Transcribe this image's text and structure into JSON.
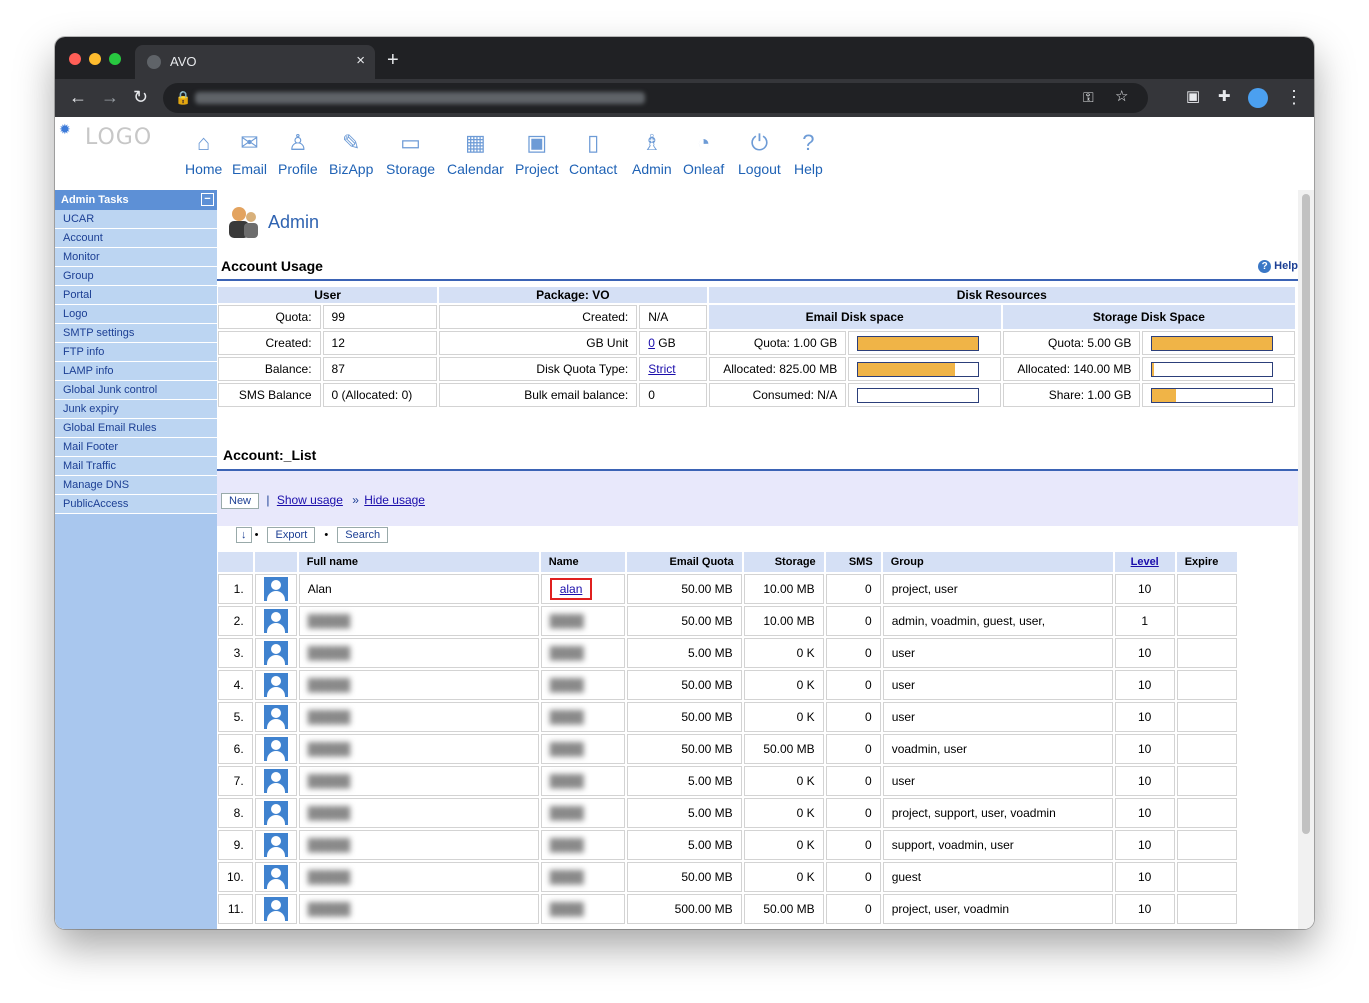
{
  "browser": {
    "tab_title": "AVO",
    "new_tab": "+",
    "close": "×"
  },
  "nav": [
    {
      "label": "Home",
      "icon": "home-icon",
      "glyph": "⌂"
    },
    {
      "label": "Email",
      "icon": "email-icon",
      "glyph": "✉"
    },
    {
      "label": "Profile",
      "icon": "profile-icon",
      "glyph": "♙"
    },
    {
      "label": "BizApp",
      "icon": "bizapp-icon",
      "glyph": "✎"
    },
    {
      "label": "Storage",
      "icon": "storage-icon",
      "glyph": "▭"
    },
    {
      "label": "Calendar",
      "icon": "calendar-icon",
      "glyph": "▦"
    },
    {
      "label": "Project",
      "icon": "project-icon",
      "glyph": "▣"
    },
    {
      "label": "Contact",
      "icon": "contact-icon",
      "glyph": "▯"
    },
    {
      "label": "Admin",
      "icon": "admin-icon",
      "glyph": "♗"
    },
    {
      "label": "Onleaf",
      "icon": "onleaf-icon",
      "glyph": "◔"
    },
    {
      "label": "Logout",
      "icon": "logout-icon",
      "glyph": "⏻"
    },
    {
      "label": "Help",
      "icon": "help-icon",
      "glyph": "?"
    }
  ],
  "logo": {
    "text": "LOGO"
  },
  "sidebar": {
    "title": "Admin Tasks",
    "collapse": "−",
    "items": [
      "UCAR",
      "Account",
      "Monitor",
      "Group",
      "Portal",
      "Logo",
      "SMTP settings",
      "FTP info",
      "LAMP info",
      "Global Junk control",
      "Junk expiry",
      "Global Email Rules",
      "Mail Footer",
      "Mail Traffic",
      "Manage DNS",
      "PublicAccess"
    ]
  },
  "main": {
    "title": "Admin",
    "usage_title": "Account Usage",
    "help": "Help",
    "headers": {
      "user": "User",
      "package": "Package: VO",
      "disk": "Disk Resources",
      "email_disk": "Email Disk space",
      "storage_disk": "Storage Disk Space"
    },
    "user_rows": [
      {
        "label": "Quota:",
        "value": "99"
      },
      {
        "label": "Created:",
        "value": "12"
      },
      {
        "label": "Balance:",
        "value": "87"
      },
      {
        "label": "SMS Balance",
        "value": "0 (Allocated: 0)"
      }
    ],
    "package_rows": [
      {
        "label": "Created:",
        "value": "N/A"
      },
      {
        "label": "GB Unit",
        "link": "0",
        "value": " GB"
      },
      {
        "label": "Disk Quota Type:",
        "link": "Strict"
      },
      {
        "label": "Bulk email balance:",
        "value": "0"
      }
    ],
    "email_disk": [
      {
        "label": "Quota: 1.00 GB",
        "level": 1.0
      },
      {
        "label": "Allocated: 825.00 MB",
        "level": 0.806
      },
      {
        "label": "Consumed: N/A",
        "level": 0
      }
    ],
    "storage_disk": [
      {
        "label": "Quota: 5.00 GB",
        "level": 1.0
      },
      {
        "label": "Allocated: 140.00 MB",
        "level": 0.027
      },
      {
        "label": "Share: 1.00 GB",
        "level": 0.2
      }
    ],
    "list_title": "Account:_List",
    "new_btn": "New",
    "sep": "|",
    "show_usage": "Show usage",
    "raquo": "»",
    "hide_usage": "Hide usage",
    "sort_btn": "↓",
    "bullet": "•",
    "export_btn": "Export",
    "search_btn": "Search",
    "columns": [
      "",
      "",
      "Full name",
      "Name",
      "Email Quota",
      "Storage",
      "SMS",
      "Group",
      "Level",
      "Expire"
    ],
    "rows": [
      {
        "n": "1.",
        "full": "Alan",
        "name": "alan",
        "quota": "50.00 MB",
        "storage": "10.00 MB",
        "sms": "0",
        "group": "project, user",
        "level": "10"
      },
      {
        "n": "2.",
        "full": "",
        "name": "",
        "quota": "50.00 MB",
        "storage": "10.00 MB",
        "sms": "0",
        "group": "admin, voadmin, guest, user,",
        "level": "1"
      },
      {
        "n": "3.",
        "full": "",
        "name": "",
        "quota": "5.00 MB",
        "storage": "0 K",
        "sms": "0",
        "group": "user",
        "level": "10"
      },
      {
        "n": "4.",
        "full": "",
        "name": "",
        "quota": "50.00 MB",
        "storage": "0 K",
        "sms": "0",
        "group": "user",
        "level": "10"
      },
      {
        "n": "5.",
        "full": "",
        "name": "",
        "quota": "50.00 MB",
        "storage": "0 K",
        "sms": "0",
        "group": "user",
        "level": "10"
      },
      {
        "n": "6.",
        "full": "",
        "name": "",
        "quota": "50.00 MB",
        "storage": "50.00 MB",
        "sms": "0",
        "group": "voadmin, user",
        "level": "10"
      },
      {
        "n": "7.",
        "full": "",
        "name": "",
        "quota": "5.00 MB",
        "storage": "0 K",
        "sms": "0",
        "group": "user",
        "level": "10"
      },
      {
        "n": "8.",
        "full": "",
        "name": "",
        "quota": "5.00 MB",
        "storage": "0 K",
        "sms": "0",
        "group": "project, support, user, voadmin",
        "level": "10"
      },
      {
        "n": "9.",
        "full": "",
        "name": "",
        "quota": "5.00 MB",
        "storage": "0 K",
        "sms": "0",
        "group": "support, voadmin, user",
        "level": "10"
      },
      {
        "n": "10.",
        "full": "",
        "name": "",
        "quota": "50.00 MB",
        "storage": "0 K",
        "sms": "0",
        "group": "guest",
        "level": "10"
      },
      {
        "n": "11.",
        "full": "",
        "name": "",
        "quota": "500.00 MB",
        "storage": "50.00 MB",
        "sms": "0",
        "group": "project, user, voadmin",
        "level": "10"
      }
    ]
  }
}
